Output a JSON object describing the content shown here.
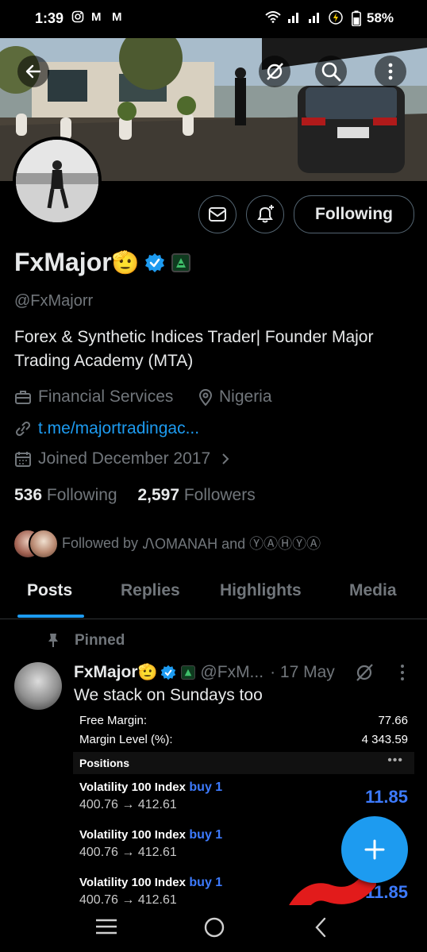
{
  "status_bar": {
    "time": "1:39",
    "battery": "58%"
  },
  "profile": {
    "display_name": "FxMajor",
    "name_emoji": "🫡",
    "handle": "@FxMajorr",
    "bio": "Forex & Synthetic Indices Trader| Founder Major Trading Academy (MTA)",
    "category": "Financial Services",
    "location": "Nigeria",
    "website": "t.me/majortradingac...",
    "joined": "Joined December 2017",
    "following_count": "536",
    "following_label": "Following",
    "followers_count": "2,597",
    "followers_label": "Followers",
    "followed_by_prefix": "Followed by",
    "followed_by_names": "ᏁOMANAH and ⓎⒶⒽⓎⒶ"
  },
  "actions": {
    "following_button": "Following"
  },
  "tabs": [
    {
      "label": "Posts",
      "active": true
    },
    {
      "label": "Replies",
      "active": false
    },
    {
      "label": "Highlights",
      "active": false
    },
    {
      "label": "Media",
      "active": false
    }
  ],
  "pinned_post": {
    "pinned_label": "Pinned",
    "author": "FxMajor",
    "author_emoji": "🫡",
    "handle": "@FxM...",
    "date": "· 17 May",
    "text": "We stack on Sundays too",
    "media": {
      "free_margin_label": "Free Margin:",
      "free_margin_value": "77.66",
      "margin_level_label": "Margin Level (%):",
      "margin_level_value": "4 343.59",
      "positions_header": "Positions",
      "positions": [
        {
          "symbol": "Volatility 100 Index",
          "side": "buy 1",
          "prices": "400.76 → 412.61",
          "profit": "11.85"
        },
        {
          "symbol": "Volatility 100 Index",
          "side": "buy 1",
          "prices": "400.76 → 412.61",
          "profit": ""
        },
        {
          "symbol": "Volatility 100 Index",
          "side": "buy 1",
          "prices": "400.76 → 412.61",
          "profit": "11.85"
        }
      ]
    }
  },
  "colors": {
    "accent": "#1d9bf0",
    "muted": "#71767b",
    "text": "#e7e9ea",
    "profit": "#3d7bff"
  },
  "icons": [
    "back-arrow-icon",
    "grok-icon",
    "search-icon",
    "more-vertical-icon",
    "mail-icon",
    "bell-plus-icon",
    "verified-badge-icon",
    "affiliate-badge-icon",
    "briefcase-icon",
    "location-pin-icon",
    "link-icon",
    "calendar-icon",
    "chevron-right-icon",
    "pin-icon",
    "plus-icon",
    "nav-recents-icon",
    "nav-home-icon",
    "nav-back-icon"
  ]
}
